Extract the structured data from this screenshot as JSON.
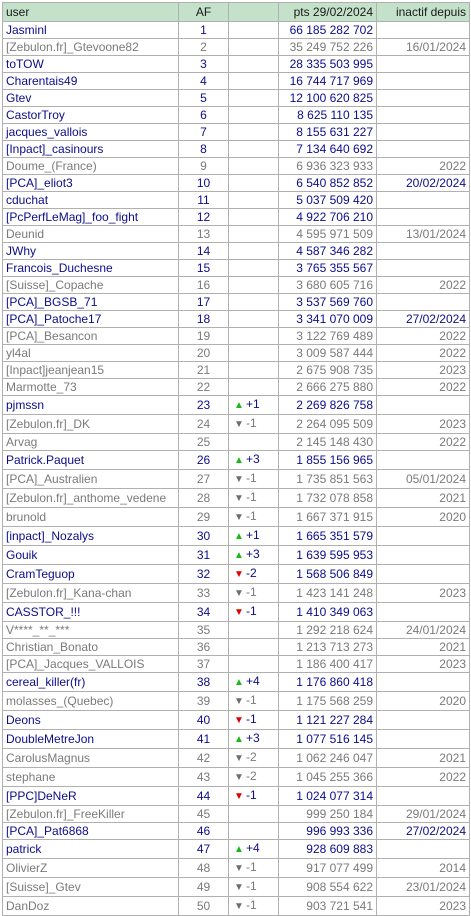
{
  "header": {
    "user": "user",
    "af": "AF",
    "pts": "pts 29/02/2024",
    "inactive": "inactif depuis"
  },
  "colors": {
    "header_bg": "#c4e2c9",
    "active_text": "#0c0c8a",
    "inactive_text": "#7a7a7a",
    "arrow_up": "#18b818",
    "arrow_down_red": "#e00000",
    "arrow_down_grey": "#6d6d6d"
  },
  "rows": [
    {
      "user": "Jasminl",
      "rank": "1",
      "arrow": "",
      "delta": "",
      "pts": "66 185 282 702",
      "since": "",
      "active": true
    },
    {
      "user": "[Zebulon.fr]_Gtevoone82",
      "rank": "2",
      "arrow": "",
      "delta": "",
      "pts": "35 249 752 226",
      "since": "16/01/2024",
      "active": false
    },
    {
      "user": "toTOW",
      "rank": "3",
      "arrow": "",
      "delta": "",
      "pts": "28 335 503 995",
      "since": "",
      "active": true
    },
    {
      "user": "Charentais49",
      "rank": "4",
      "arrow": "",
      "delta": "",
      "pts": "16 744 717 969",
      "since": "",
      "active": true
    },
    {
      "user": "Gtev",
      "rank": "5",
      "arrow": "",
      "delta": "",
      "pts": "12 100 620 825",
      "since": "",
      "active": true
    },
    {
      "user": "CastorTroy",
      "rank": "6",
      "arrow": "",
      "delta": "",
      "pts": "8 625 110 135",
      "since": "",
      "active": true
    },
    {
      "user": "jacques_vallois",
      "rank": "7",
      "arrow": "",
      "delta": "",
      "pts": "8 155 631 227",
      "since": "",
      "active": true
    },
    {
      "user": "[Inpact]_casinours",
      "rank": "8",
      "arrow": "",
      "delta": "",
      "pts": "7 134 640 692",
      "since": "",
      "active": true
    },
    {
      "user": "Doume_(France)",
      "rank": "9",
      "arrow": "",
      "delta": "",
      "pts": "6 936 323 933",
      "since": "2022",
      "active": false
    },
    {
      "user": "[PCA]_eliot3",
      "rank": "10",
      "arrow": "",
      "delta": "",
      "pts": "6 540 852 852",
      "since": "20/02/2024",
      "active": true
    },
    {
      "user": "cduchat",
      "rank": "11",
      "arrow": "",
      "delta": "",
      "pts": "5 037 509 420",
      "since": "",
      "active": true
    },
    {
      "user": "[PcPerfLeMag]_foo_fight",
      "rank": "12",
      "arrow": "",
      "delta": "",
      "pts": "4 922 706 210",
      "since": "",
      "active": true
    },
    {
      "user": "Deunid",
      "rank": "13",
      "arrow": "",
      "delta": "",
      "pts": "4 595 971 509",
      "since": "13/01/2024",
      "active": false
    },
    {
      "user": "JWhy",
      "rank": "14",
      "arrow": "",
      "delta": "",
      "pts": "4 587 346 282",
      "since": "",
      "active": true
    },
    {
      "user": "Francois_Duchesne",
      "rank": "15",
      "arrow": "",
      "delta": "",
      "pts": "3 765 355 567",
      "since": "",
      "active": true
    },
    {
      "user": "[Suisse]_Copache",
      "rank": "16",
      "arrow": "",
      "delta": "",
      "pts": "3 680 605 716",
      "since": "2022",
      "active": false
    },
    {
      "user": "[PCA]_BGSB_71",
      "rank": "17",
      "arrow": "",
      "delta": "",
      "pts": "3 537 569 760",
      "since": "",
      "active": true
    },
    {
      "user": "[PCA]_Patoche17",
      "rank": "18",
      "arrow": "",
      "delta": "",
      "pts": "3 341 070 009",
      "since": "27/02/2024",
      "active": true
    },
    {
      "user": "[PCA]_Besancon",
      "rank": "19",
      "arrow": "",
      "delta": "",
      "pts": "3 122 769 489",
      "since": "2022",
      "active": false
    },
    {
      "user": "yl4al",
      "rank": "20",
      "arrow": "",
      "delta": "",
      "pts": "3 009 587 444",
      "since": "2022",
      "active": false
    },
    {
      "user": "[Inpact]jeanjean15",
      "rank": "21",
      "arrow": "",
      "delta": "",
      "pts": "2 675 908 735",
      "since": "2023",
      "active": false
    },
    {
      "user": "Marmotte_73",
      "rank": "22",
      "arrow": "",
      "delta": "",
      "pts": "2 666 275 880",
      "since": "2022",
      "active": false
    },
    {
      "user": "pjmssn",
      "rank": "23",
      "arrow": "up",
      "delta": "+1",
      "pts": "2 269 826 758",
      "since": "",
      "active": true
    },
    {
      "user": "[Zebulon.fr]_DK",
      "rank": "24",
      "arrow": "down-grey",
      "delta": "-1",
      "pts": "2 264 095 509",
      "since": "2023",
      "active": false
    },
    {
      "user": "Arvag",
      "rank": "25",
      "arrow": "",
      "delta": "",
      "pts": "2 145 148 430",
      "since": "2022",
      "active": false
    },
    {
      "user": "Patrick.Paquet",
      "rank": "26",
      "arrow": "up",
      "delta": "+3",
      "pts": "1 855 156 965",
      "since": "",
      "active": true
    },
    {
      "user": "[PCA]_Australien",
      "rank": "27",
      "arrow": "down-grey",
      "delta": "-1",
      "pts": "1 735 851 563",
      "since": "05/01/2024",
      "active": false
    },
    {
      "user": "[Zebulon.fr]_anthome_vedene",
      "rank": "28",
      "arrow": "down-grey",
      "delta": "-1",
      "pts": "1 732 078 858",
      "since": "2021",
      "active": false
    },
    {
      "user": "brunold",
      "rank": "29",
      "arrow": "down-grey",
      "delta": "-1",
      "pts": "1 667 371 915",
      "since": "2020",
      "active": false
    },
    {
      "user": "[inpact]_Nozalys",
      "rank": "30",
      "arrow": "up",
      "delta": "+1",
      "pts": "1 665 351 579",
      "since": "",
      "active": true
    },
    {
      "user": "Gouik",
      "rank": "31",
      "arrow": "up",
      "delta": "+3",
      "pts": "1 639 595 953",
      "since": "",
      "active": true
    },
    {
      "user": "CramTeguop",
      "rank": "32",
      "arrow": "down-red",
      "delta": "-2",
      "pts": "1 568 506 849",
      "since": "",
      "active": true
    },
    {
      "user": "[Zebulon.fr]_Kana-chan",
      "rank": "33",
      "arrow": "down-grey",
      "delta": "-1",
      "pts": "1 423 141 248",
      "since": "2023",
      "active": false
    },
    {
      "user": "CASSTOR_!!!",
      "rank": "34",
      "arrow": "down-red",
      "delta": "-1",
      "pts": "1 410 349 063",
      "since": "",
      "active": true
    },
    {
      "user": "V****_**_***",
      "rank": "35",
      "arrow": "",
      "delta": "",
      "pts": "1 292 218 624",
      "since": "24/01/2024",
      "active": false
    },
    {
      "user": "Christian_Bonato",
      "rank": "36",
      "arrow": "",
      "delta": "",
      "pts": "1 213 713 273",
      "since": "2021",
      "active": false
    },
    {
      "user": "[PCA]_Jacques_VALLOIS",
      "rank": "37",
      "arrow": "",
      "delta": "",
      "pts": "1 186 400 417",
      "since": "2023",
      "active": false
    },
    {
      "user": "cereal_killer(fr)",
      "rank": "38",
      "arrow": "up",
      "delta": "+4",
      "pts": "1 176 860 418",
      "since": "",
      "active": true
    },
    {
      "user": "molasses_(Quebec)",
      "rank": "39",
      "arrow": "down-grey",
      "delta": "-1",
      "pts": "1 175 568 259",
      "since": "2020",
      "active": false
    },
    {
      "user": "Deons",
      "rank": "40",
      "arrow": "down-red",
      "delta": "-1",
      "pts": "1 121 227 284",
      "since": "",
      "active": true
    },
    {
      "user": "DoubleMetreJon",
      "rank": "41",
      "arrow": "up",
      "delta": "+3",
      "pts": "1 077 516 145",
      "since": "",
      "active": true
    },
    {
      "user": "CarolusMagnus",
      "rank": "42",
      "arrow": "down-grey",
      "delta": "-2",
      "pts": "1 062 246 047",
      "since": "2021",
      "active": false
    },
    {
      "user": "stephane",
      "rank": "43",
      "arrow": "down-grey",
      "delta": "-2",
      "pts": "1 045 255 366",
      "since": "2022",
      "active": false
    },
    {
      "user": "[PPC]DeNeR",
      "rank": "44",
      "arrow": "down-red",
      "delta": "-1",
      "pts": "1 024 077 314",
      "since": "",
      "active": true
    },
    {
      "user": "[Zebulon.fr]_FreeKiller",
      "rank": "45",
      "arrow": "",
      "delta": "",
      "pts": "999 250 184",
      "since": "29/01/2024",
      "active": false
    },
    {
      "user": "[PCA]_Pat6868",
      "rank": "46",
      "arrow": "",
      "delta": "",
      "pts": "996 993 336",
      "since": "27/02/2024",
      "active": true
    },
    {
      "user": "patrick",
      "rank": "47",
      "arrow": "up",
      "delta": "+4",
      "pts": "928 609 883",
      "since": "",
      "active": true
    },
    {
      "user": "OlivierZ",
      "rank": "48",
      "arrow": "down-grey",
      "delta": "-1",
      "pts": "917 077 499",
      "since": "2014",
      "active": false
    },
    {
      "user": "[Suisse]_Gtev",
      "rank": "49",
      "arrow": "down-grey",
      "delta": "-1",
      "pts": "908 554 622",
      "since": "23/01/2024",
      "active": false
    },
    {
      "user": "DanDoz",
      "rank": "50",
      "arrow": "down-grey",
      "delta": "-1",
      "pts": "903 721 541",
      "since": "2023",
      "active": false
    }
  ]
}
